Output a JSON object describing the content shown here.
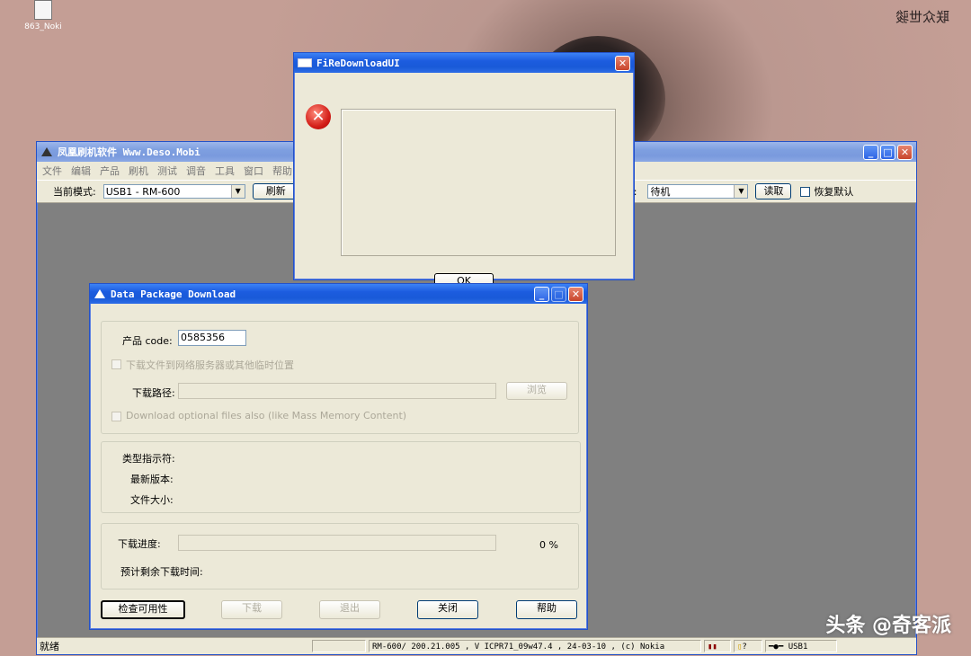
{
  "desktop": {
    "icon_label": "863_Noki",
    "top_right_text": "联众世骏"
  },
  "main": {
    "title": "凤凰刷机软件 Www.Deso.Mobi",
    "menu": [
      "文件",
      "编辑",
      "产品",
      "刷机",
      "测试",
      "调音",
      "工具",
      "窗口",
      "帮助"
    ],
    "mode_label": "当前模式:",
    "mode_value": "USB1 - RM-600",
    "refresh_btn": "刷新",
    "mode2_label": "式:",
    "mode2_value": "待机",
    "read_btn": "读取",
    "restore_label": "恢复默认",
    "status": {
      "ready": "就绪",
      "info": "RM-600/ 200.21.005 , V ICPR71_09w47.4 , 24-03-10 , (c) Nokia",
      "question": "?",
      "conn": "USB1"
    }
  },
  "error_dialog": {
    "title": "FiReDownloadUI",
    "ok_label": "OK"
  },
  "download_dialog": {
    "title": "Data Package Download",
    "product_code_label": "产品 code:",
    "product_code_value": "0585356",
    "net_server_label": "下载文件到网络服务器或其他临时位置",
    "path_label": "下载路径:",
    "browse_btn": "浏览",
    "optional_label": "Download optional files also (like Mass Memory Content)",
    "type_label": "类型指示符:",
    "latest_label": "最新版本:",
    "size_label": "文件大小:",
    "progress_label": "下载进度:",
    "progress_value": "0 %",
    "progress_fraction": 0,
    "remaining_label": "预计剩余下载时间:",
    "buttons": {
      "check": "检查可用性",
      "download": "下载",
      "exit": "退出",
      "close": "关闭",
      "help": "帮助"
    }
  },
  "watermark": "头条 @奇客派"
}
